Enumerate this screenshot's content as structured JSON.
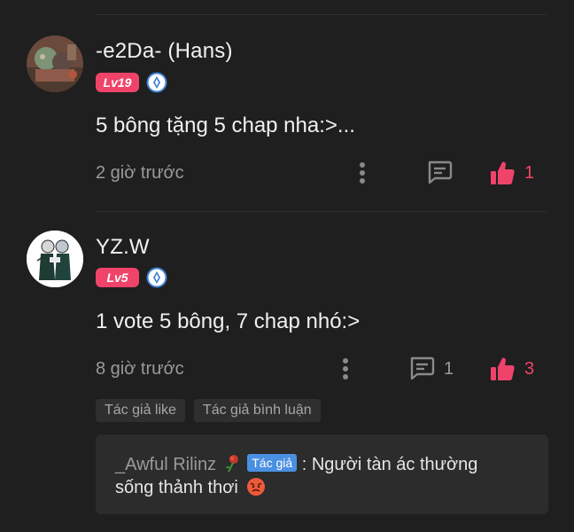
{
  "comments": [
    {
      "username": "-e2Da- (Hans)",
      "level": "Lv19",
      "text": "5 bông tặng 5 chap nha:>...",
      "time": "2 giờ trước",
      "reply_count": "",
      "like_count": "1"
    },
    {
      "username": "YZ.W",
      "level": "Lv5",
      "text": "1 vote 5 bông, 7 chap nhó:>",
      "time": "8 giờ trước",
      "reply_count": "1",
      "like_count": "3",
      "chips": [
        "Tác giả like",
        "Tác giả bình luận"
      ],
      "reply": {
        "author": "_Awful Rilinz",
        "author_tag": "Tác giả",
        "text_line1": ": Người tàn ác thường",
        "text_line2": "sống thảnh thơi"
      }
    }
  ],
  "colors": {
    "background": "#1f1f1f",
    "accent": "#f0436a",
    "muted_text": "#9a9a9a",
    "author_tag": "#4a90e2"
  },
  "icons": [
    "ring-badge-icon",
    "more-icon",
    "reply-icon",
    "thumbs-up-icon",
    "rose-icon",
    "angry-emoji-icon"
  ]
}
